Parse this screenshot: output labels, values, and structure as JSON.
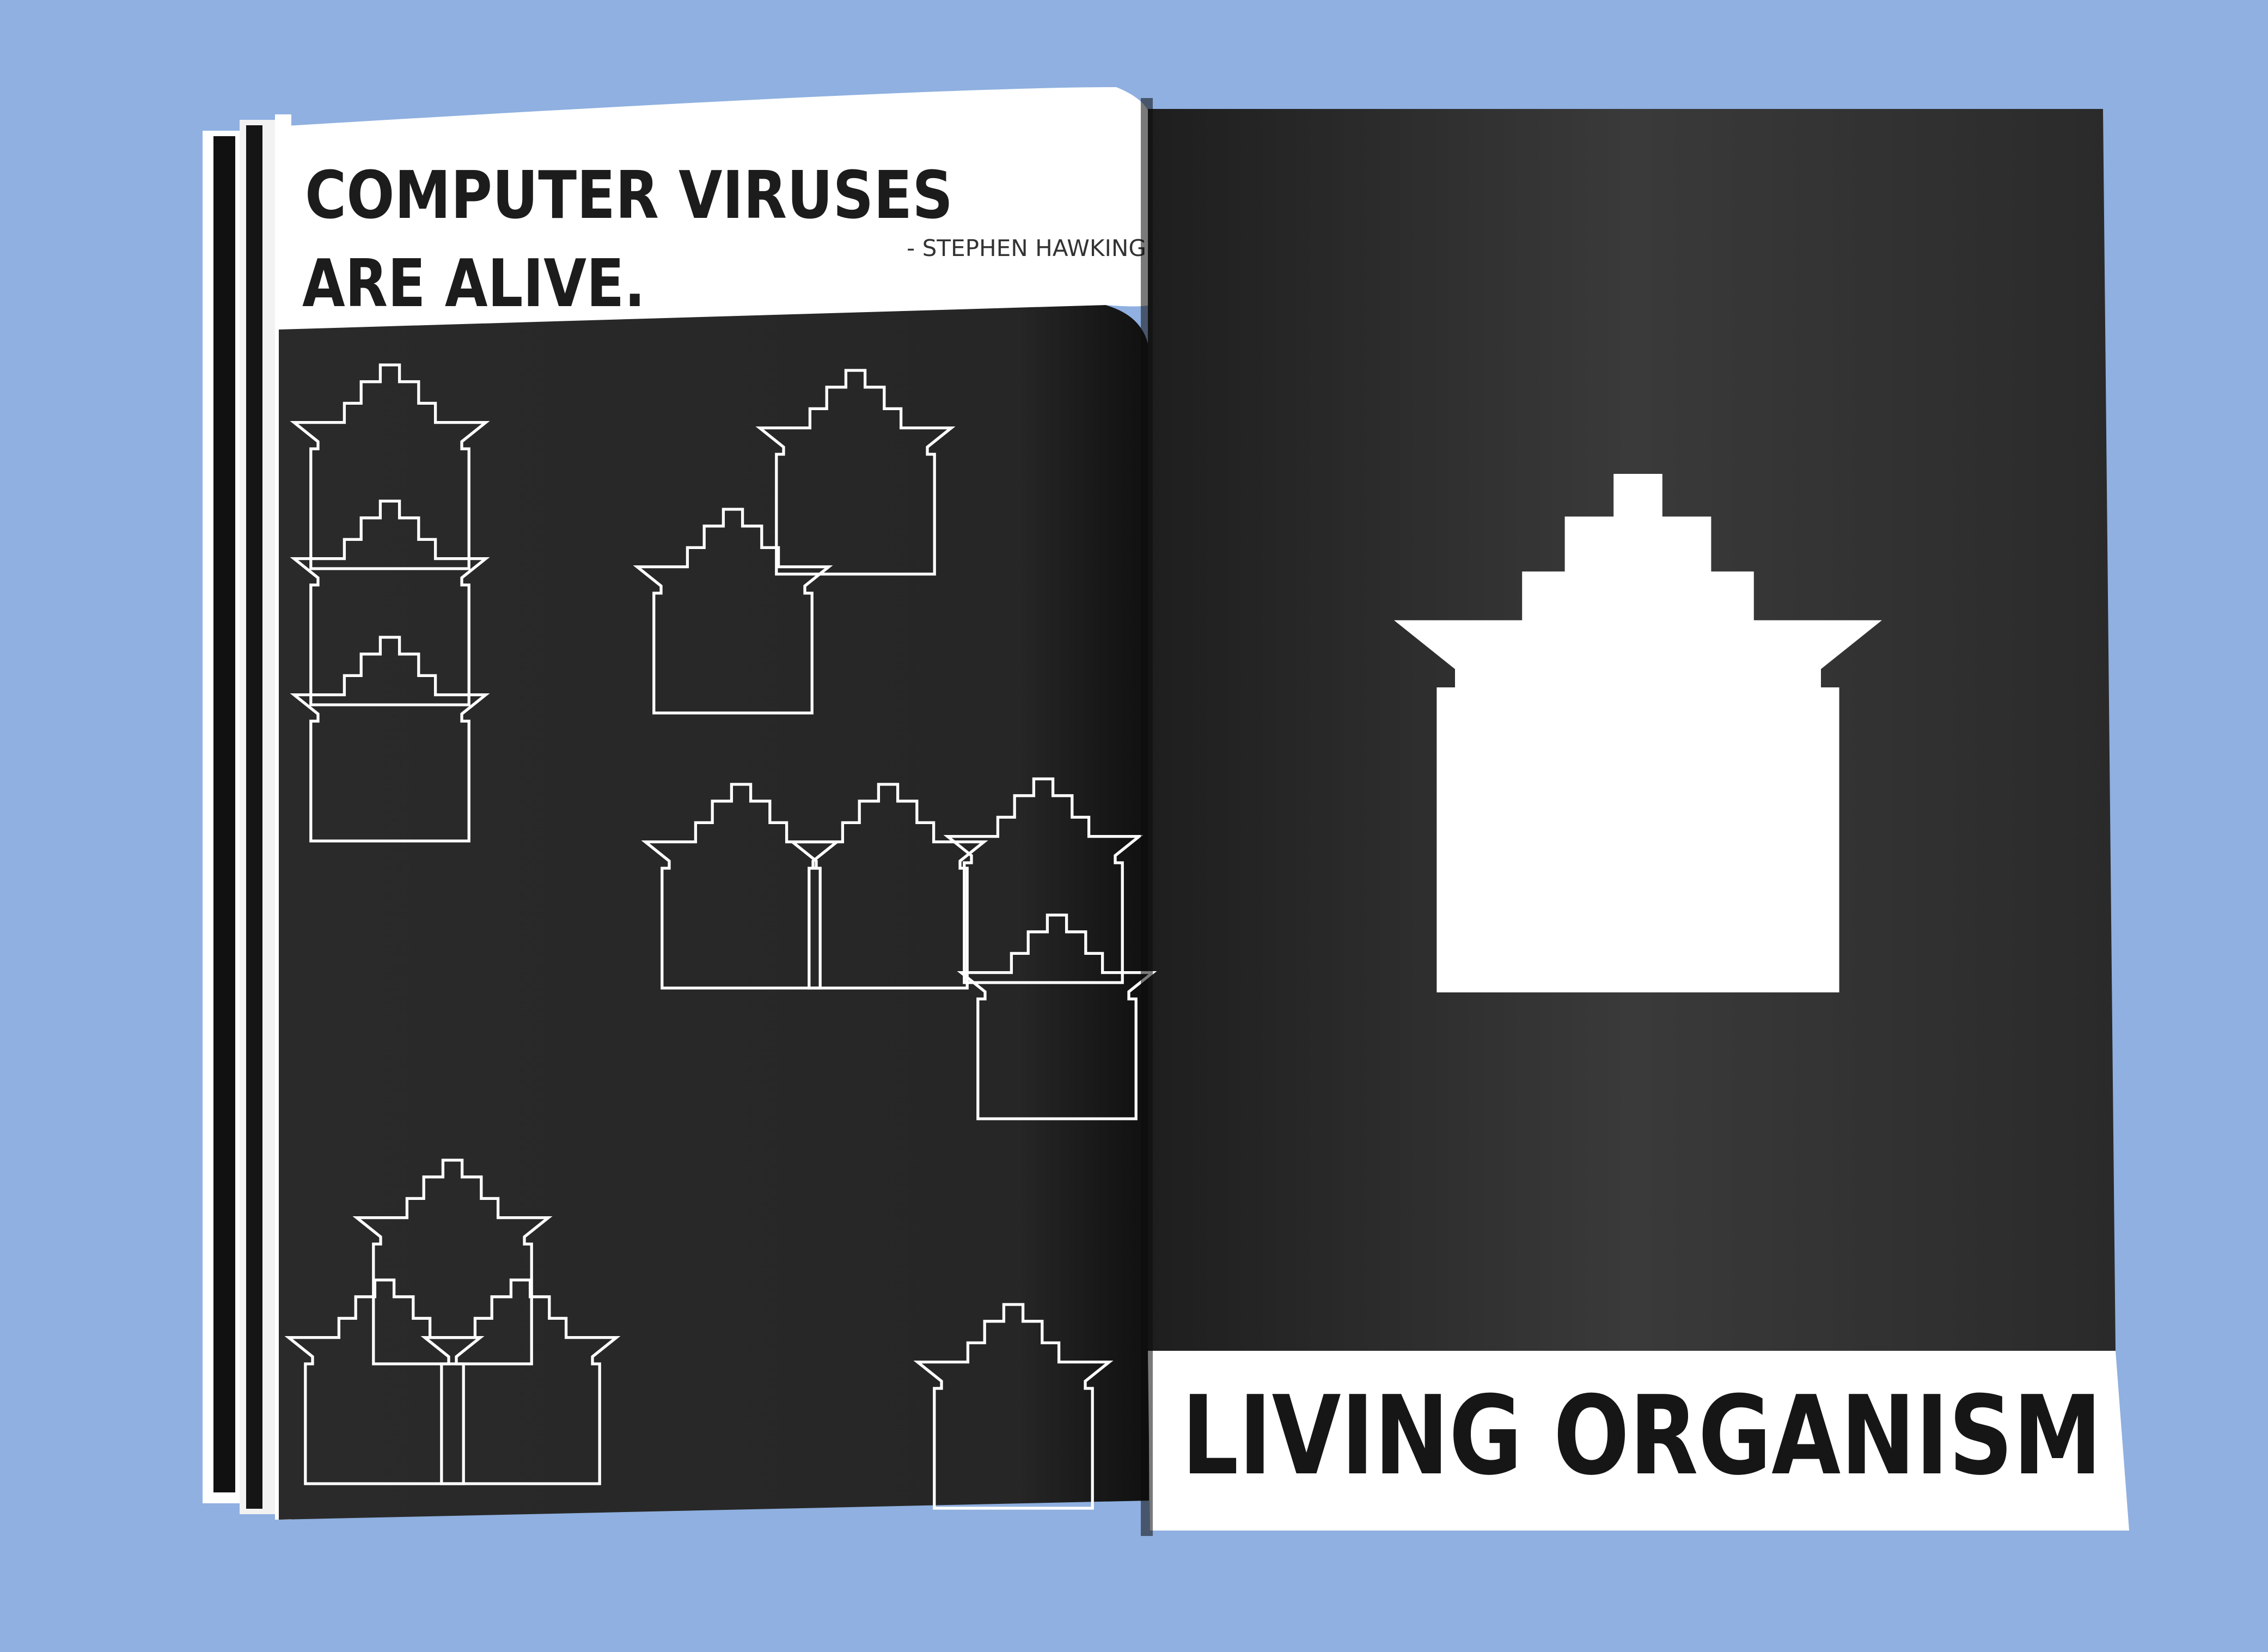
{
  "colors": {
    "background": "#8fb0e0",
    "page_black": "#262626",
    "page_white": "#ffffff",
    "text_dark": "#1c1c1c"
  },
  "left_page": {
    "quote_line_1": "COMPUTER VIRUSES",
    "quote_line_2": "ARE ALIVE.",
    "attribution": "- STEPHEN HAWKING"
  },
  "right_page": {
    "headline": "LIVING ORGANISM"
  },
  "icons": {
    "house_outline": "arrow-house-outline-icon",
    "house_solid": "arrow-house-solid-icon"
  }
}
